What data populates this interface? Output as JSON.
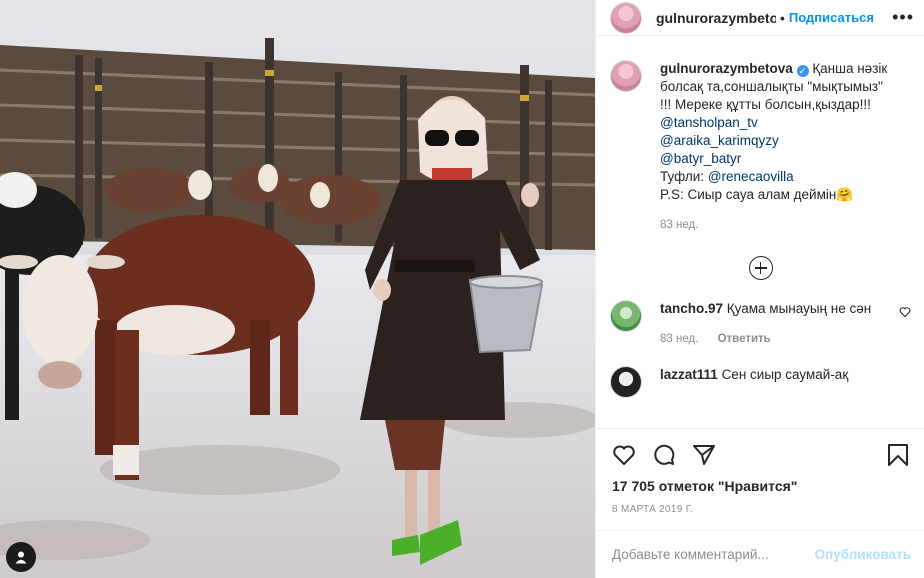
{
  "post": {
    "username": "gulnurorazymbetova",
    "header_username_display": "gulnurorazymbetov",
    "follow_label": "Подписаться",
    "more_label": "•••",
    "caption_text": "Қанша нәзік болсақ та,соншалықты \"мықтымыз\" !!! Мереке құтты болсын,қыздар!!!",
    "mentions": [
      "@tansholpan_tv",
      "@araika_karimqyzy",
      "@batyr_batyr"
    ],
    "shoes_label": "Туфли:",
    "shoes_mention": "@renecaovilla",
    "ps_line": "P.S: Сиыр сауа алам деймін🤗",
    "caption_time": "83 нед.",
    "likes": "17 705 отметок \"Нравится\"",
    "date": "8 МАРТА 2019 Г.",
    "comment_placeholder": "Добавьте комментарий...",
    "publish_label": "Опубликовать"
  },
  "comments": [
    {
      "username": "tancho.97",
      "text": "Қуама мынауың не сән",
      "time": "83 нед.",
      "reply_label": "Ответить"
    },
    {
      "username": "lazzat111",
      "text": "Сен сиыр саумай-ақ",
      "time": "",
      "reply_label": ""
    }
  ],
  "icons": {
    "like": "heart-icon",
    "comment": "comment-icon",
    "share": "share-icon",
    "save": "bookmark-icon",
    "load_more": "plus-circle-icon",
    "tagged": "user-tag-icon"
  },
  "colors": {
    "link": "#0095f6",
    "mention": "#00376b",
    "muted": "#8e8e8e",
    "verified": "#3897f0"
  }
}
